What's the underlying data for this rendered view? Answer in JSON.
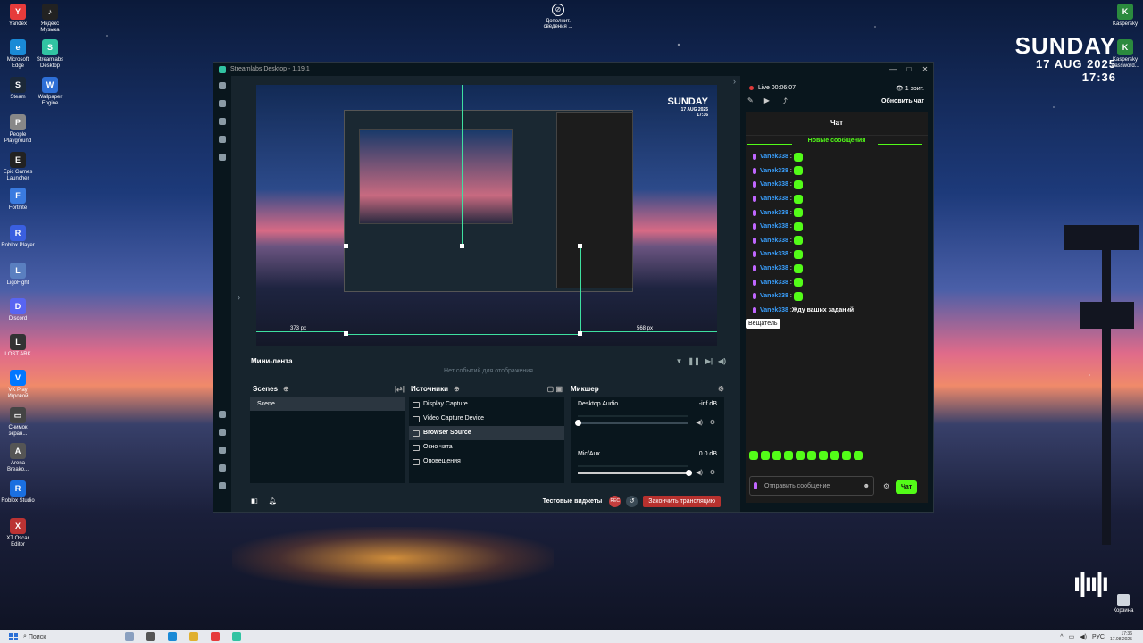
{
  "desktop": {
    "icons_left": [
      {
        "label": "Yandex",
        "glyph": "Y",
        "color": "#e63b3b"
      },
      {
        "label": "Яндекс Музыка",
        "glyph": "♪",
        "color": "#222"
      },
      {
        "label": "Microsoft Edge",
        "glyph": "e",
        "color": "#1a8ad6"
      },
      {
        "label": "Streamlabs Desktop",
        "glyph": "S",
        "color": "#31c3a2"
      },
      {
        "label": "Steam",
        "glyph": "S",
        "color": "#1b2838"
      },
      {
        "label": "Wallpaper Engine",
        "glyph": "W",
        "color": "#2e6fd6"
      },
      {
        "label": "People Playground",
        "glyph": "P",
        "color": "#888"
      },
      {
        "label": "Epic Games Launcher",
        "glyph": "E",
        "color": "#222"
      },
      {
        "label": "Fortnite",
        "glyph": "F",
        "color": "#3a7be0"
      },
      {
        "label": "Roblox Player",
        "glyph": "R",
        "color": "#3a5fe0"
      },
      {
        "label": "LigoFight",
        "glyph": "L",
        "color": "#5a7fc0"
      },
      {
        "label": "Discord",
        "glyph": "D",
        "color": "#5865f2"
      },
      {
        "label": "LOST ARK",
        "glyph": "L",
        "color": "#333"
      },
      {
        "label": "VK Play Игровой",
        "glyph": "V",
        "color": "#0077ff"
      },
      {
        "label": "Снимок экран...",
        "glyph": "▭",
        "color": "#444"
      },
      {
        "label": "Arena Breako...",
        "glyph": "A",
        "color": "#555"
      },
      {
        "label": "Roblox Studio",
        "glyph": "R",
        "color": "#1a6fe0"
      },
      {
        "label": "XT Oscar Editor",
        "glyph": "X",
        "color": "#b33"
      }
    ],
    "icons_right": [
      {
        "label": "Kaspersky",
        "glyph": "K"
      },
      {
        "label": "Kaspersky Password...",
        "glyph": "K"
      }
    ],
    "center_icon": {
      "label": "Дополнит. сведения ..."
    },
    "clock": {
      "day": "SUNDAY",
      "date": "17 AUG 2025",
      "time": "17:36"
    },
    "trash_label": "Корзина"
  },
  "app": {
    "title": "Streamlabs Desktop - 1.19.1",
    "window_controls": {
      "minimize": "—",
      "maximize": "□",
      "close": "✕"
    },
    "preview": {
      "inner_day": "SUNDAY",
      "inner_date": "17 AUG 2025",
      "inner_time": "17:36",
      "px_left": "373 px",
      "px_right": "568 px"
    },
    "minifeed": {
      "title": "Мини-лента",
      "empty": "Нет событий для отображения"
    },
    "scenes": {
      "title": "Scenes",
      "items": [
        "Scene"
      ]
    },
    "sources": {
      "title": "Источники",
      "items": [
        {
          "label": "Display Capture",
          "selected": false
        },
        {
          "label": "Video Capture Device",
          "selected": false
        },
        {
          "label": "Browser Source",
          "selected": true
        },
        {
          "label": "Окно чата",
          "selected": false
        },
        {
          "label": "Оповещения",
          "selected": false
        }
      ]
    },
    "mixer": {
      "title": "Микшер",
      "channels": [
        {
          "name": "Desktop Audio",
          "db": "-inf dB",
          "volume": 0.0
        },
        {
          "name": "Mic/Aux",
          "db": "0.0 dB",
          "volume": 1.0
        }
      ]
    },
    "footer": {
      "test_widgets": "Тестовые виджеты",
      "rec": "REC",
      "end_stream": "Закончить трансляцию"
    },
    "chat": {
      "live": "Live 00:06:07",
      "viewers": "1 зрит.",
      "refresh": "Обновить чат",
      "title": "Чат",
      "new_messages": "Новые сообщения",
      "messages": [
        {
          "user": "Vanek338",
          "text": ""
        },
        {
          "user": "Vanek338",
          "text": ""
        },
        {
          "user": "Vanek338",
          "text": ""
        },
        {
          "user": "Vanek338",
          "text": ""
        },
        {
          "user": "Vanek338",
          "text": ""
        },
        {
          "user": "Vanek338",
          "text": ""
        },
        {
          "user": "Vanek338",
          "text": ""
        },
        {
          "user": "Vanek338",
          "text": ""
        },
        {
          "user": "Vanek338",
          "text": ""
        },
        {
          "user": "Vanek338",
          "text": ""
        },
        {
          "user": "Vanek338",
          "text": ""
        },
        {
          "user": "Vanek338",
          "text": "Жду ваших заданий"
        }
      ],
      "tooltip": "Вещатель",
      "input_placeholder": "Отправить сообщение",
      "send": "Чат"
    }
  },
  "taskbar": {
    "search": "Поиск",
    "lang": "РУС",
    "time": "17:36",
    "date": "17.08.2025"
  }
}
